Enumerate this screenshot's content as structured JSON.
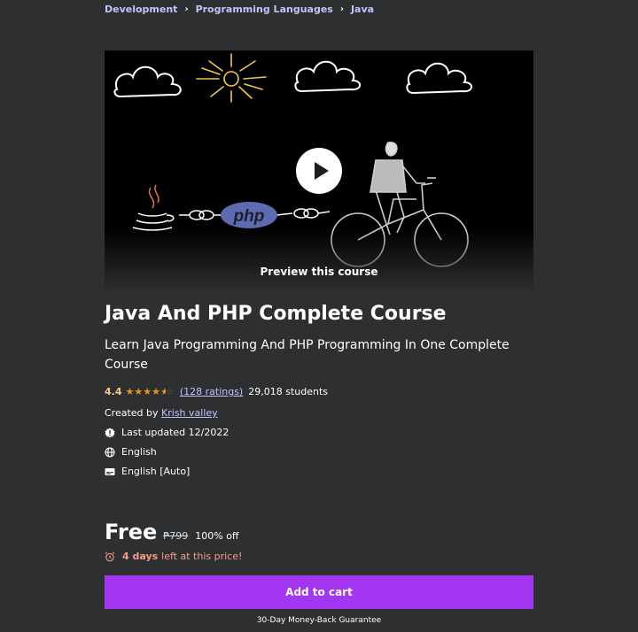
{
  "breadcrumb": {
    "items": [
      "Development",
      "Programming Languages",
      "Java"
    ],
    "separator": "›"
  },
  "preview": {
    "label": "Preview this course",
    "php_logo_text": "php"
  },
  "course": {
    "title": "Java And PHP Complete Course",
    "subtitle": "Learn Java Programming And PHP Programming In One Complete Course",
    "rating_value": "4.4",
    "rating_stars": 4.4,
    "ratings_count": "(128 ratings)",
    "students": "29,018 students",
    "created_by_label": "Created by",
    "creator": "Krish valley",
    "last_updated": "Last updated 12/2022",
    "language": "English",
    "captions": "English [Auto]"
  },
  "pricing": {
    "price": "Free",
    "original_price": "₱799",
    "discount": "100% off",
    "days_left": "4 days",
    "timer_suffix": "left at this price!",
    "add_to_cart": "Add to cart",
    "guarantee": "30-Day Money-Back Guarantee"
  },
  "colors": {
    "background": "#2d2f31",
    "accent": "#a435f0",
    "link": "#c0c4fc",
    "star": "#e59819",
    "alarm": "#f69c8a"
  },
  "icons": {
    "updated": "alert-badge-icon",
    "language": "globe-icon",
    "captions": "closed-captions-icon",
    "timer": "alarm-clock-icon"
  }
}
